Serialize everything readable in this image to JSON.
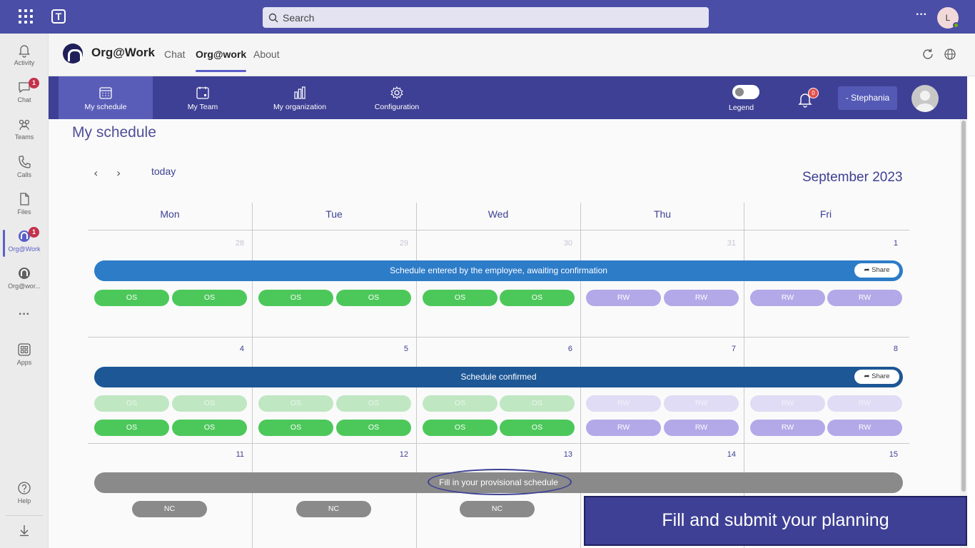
{
  "teams": {
    "search_placeholder": "Search",
    "more_label": "···",
    "avatar_initial": "L",
    "rail": [
      {
        "label": "Activity",
        "icon": "bell-icon"
      },
      {
        "label": "Chat",
        "icon": "chat-icon",
        "badge": "1"
      },
      {
        "label": "Teams",
        "icon": "teams-icon"
      },
      {
        "label": "Calls",
        "icon": "phone-icon"
      },
      {
        "label": "Files",
        "icon": "file-icon"
      },
      {
        "label": "Org@Work",
        "icon": "orgwork-icon",
        "badge": "1"
      },
      {
        "label": "Org@wor...",
        "icon": "orgwork-icon"
      },
      {
        "label": "Apps",
        "icon": "apps-icon"
      },
      {
        "label": "Help",
        "icon": "help-icon"
      }
    ],
    "rail_more": "···"
  },
  "app": {
    "name": "Org@Work",
    "tabs": [
      "Chat",
      "Org@work",
      "About"
    ],
    "active_tab": "Org@work"
  },
  "nav": {
    "items": [
      "My schedule",
      "My Team",
      "My organization",
      "Configuration"
    ],
    "legend_label": "Legend",
    "notification_count": "0",
    "user_label": "- Stephania"
  },
  "schedule": {
    "page_title": "My schedule",
    "prev_arrow": "‹",
    "next_arrow": "›",
    "today_label": "today",
    "month_label": "September 2023",
    "days": [
      "Mon",
      "Tue",
      "Wed",
      "Thu",
      "Fri"
    ],
    "weeks": [
      {
        "dates": [
          "28",
          "29",
          "30",
          "31",
          "1"
        ],
        "band": "Schedule entered by the employee, awaiting confirmation",
        "share": "Share",
        "rows": [
          [
            "OS",
            "OS",
            "OS",
            "OS",
            "OS",
            "OS",
            "RW",
            "RW",
            "RW",
            "RW"
          ]
        ]
      },
      {
        "dates": [
          "4",
          "5",
          "6",
          "7",
          "8"
        ],
        "band": "Schedule confirmed",
        "share": "Share",
        "rows": [
          [
            "OS",
            "OS",
            "OS",
            "OS",
            "OS",
            "OS",
            "RW",
            "RW",
            "RW",
            "RW"
          ],
          [
            "OS",
            "OS",
            "OS",
            "OS",
            "OS",
            "OS",
            "RW",
            "RW",
            "RW",
            "RW"
          ]
        ]
      },
      {
        "dates": [
          "11",
          "12",
          "13",
          "14",
          "15"
        ],
        "band": "Fill in your provisional schedule",
        "rows": [
          [
            "NC",
            "NC",
            "NC"
          ]
        ]
      }
    ]
  },
  "colors": {
    "awaiting_band": "#2d7cc8",
    "confirmed_band": "#1d5795",
    "provisional_band": "#8a8a8a",
    "office_pill": "#4cc85a",
    "remote_pill": "#b3a9e8"
  },
  "overlay_caption": "Fill and submit your planning"
}
